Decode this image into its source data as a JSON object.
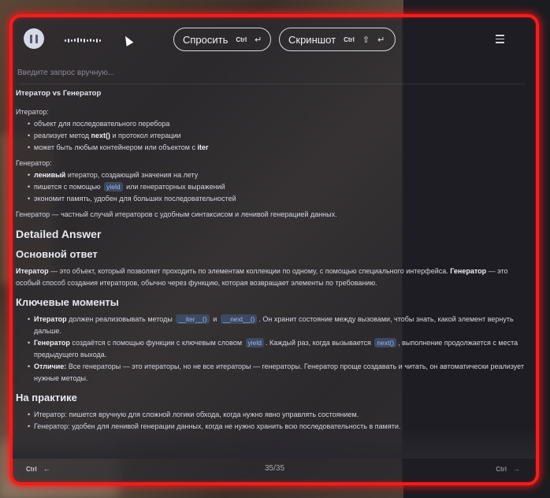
{
  "toolbar": {
    "ask_label": "Спросить",
    "ask_modifier": "Ctrl",
    "ask_key": "↵",
    "screenshot_label": "Скриншот",
    "screenshot_modifier": "Ctrl",
    "screenshot_shift": "⇧",
    "screenshot_key": "↵"
  },
  "input": {
    "placeholder": "Введите запрос вручную..."
  },
  "summary": {
    "title": "Итератор vs Генератор",
    "iterator_heading": "Итератор:",
    "iterator_items": [
      "объект для последовательного перебора",
      [
        "реализует метод ",
        "next()",
        " и протокол итерации"
      ],
      [
        "может быть любым контейнером или объектом с ",
        "iter"
      ]
    ],
    "generator_heading": "Генератор:",
    "generator_items": [
      [
        "ленивый",
        " итератор, создающий значения на лету"
      ],
      [
        "пишется с помощью ",
        "yield",
        " или генераторных выражений"
      ],
      "экономит память, удобен для больших последовательностей"
    ],
    "conclusion": "Генератор — частный случай итераторов с удобным синтаксисом и ленивой генерацией данных."
  },
  "detailed": {
    "heading": "Detailed Answer",
    "main_heading": "Основной ответ",
    "main_para": [
      "Итератор",
      " — это объект, который позволяет проходить по элементам коллекции по одному, с помощью специального интерфейса. ",
      "Генератор",
      " — это особый способ создания итераторов, обычно через функцию, которая возвращает элементы по требованию."
    ],
    "key_heading": "Ключевые моменты",
    "key_items": [
      [
        "Итератор",
        " должен реализовывать методы ",
        "__iter__()",
        " и ",
        "__next__()",
        ". Он хранит состояние между вызовами, чтобы знать, какой элемент вернуть дальше."
      ],
      [
        "Генератор",
        " создаётся с помощью функции с ключевым словом ",
        "yield",
        ". Каждый раз, когда вызывается ",
        "next()",
        ", выполнение продолжается с места предыдущего выхода."
      ],
      [
        "Отличие:",
        " Все генераторы — это итераторы, но не все итераторы — генераторы. Генератор проще создавать и читать, он автоматически реализует нужные методы."
      ]
    ],
    "practice_heading": "На практике",
    "practice_items": [
      "Итератор: пишется вручную для сложной логики обхода, когда нужно явно управлять состоянием.",
      "Генератор: удобен для ленивой генерации данных, когда не нужно хранить всю последовательность в памяти."
    ]
  },
  "footer": {
    "left_modifier": "Ctrl",
    "left_arrow": "←",
    "page": "35/35",
    "right_modifier": "Ctrl",
    "right_arrow": "→"
  }
}
